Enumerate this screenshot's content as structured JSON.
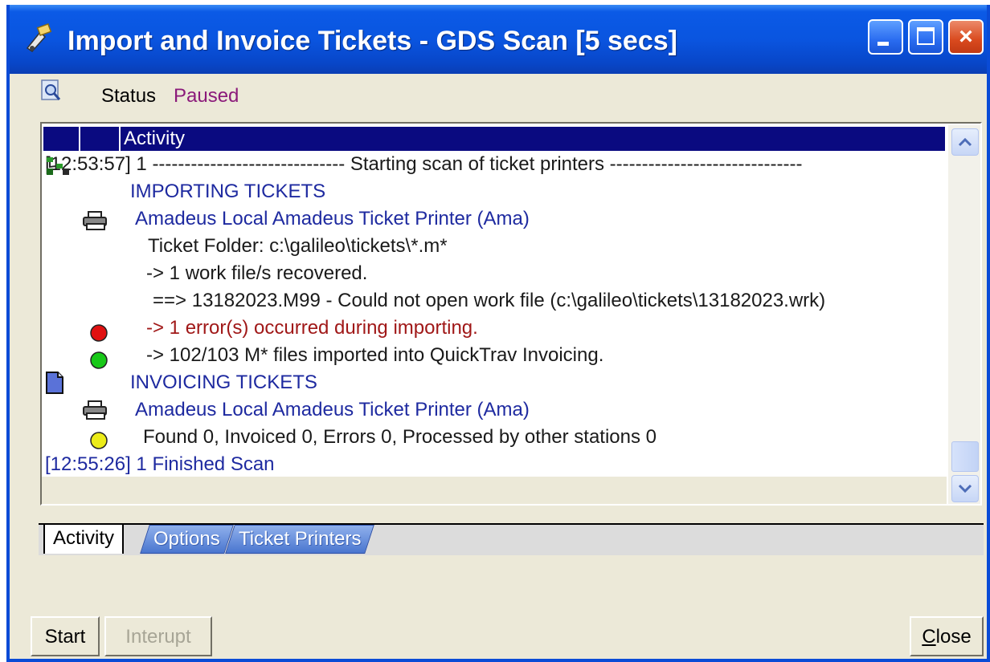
{
  "window": {
    "title": "Import and Invoice Tickets - GDS Scan [5 secs]",
    "controls": {
      "minimize": "minimize",
      "maximize": "maximize",
      "close": "×"
    }
  },
  "status": {
    "label": "Status",
    "value": "Paused"
  },
  "activity_list": {
    "header": "Activity",
    "rows": [
      {
        "text": "[12:53:57] 1 ------------------------------ Starting scan of ticket printers ------------------------------",
        "color": "black"
      },
      {
        "icon": "import-tickets-icon",
        "text": "IMPORTING TICKETS",
        "color": "blue"
      },
      {
        "icon": "printer-icon",
        "text": "Amadeus Local Amadeus Ticket Printer (Ama)",
        "color": "blue"
      },
      {
        "text": "Ticket Folder: c:\\galileo\\tickets\\*.m*",
        "color": "black"
      },
      {
        "text": "-> 1 work file/s recovered.",
        "color": "black"
      },
      {
        "text": "==> 13182023.M99 - Could not open work file (c:\\galileo\\tickets\\13182023.wrk)",
        "color": "black"
      },
      {
        "icon": "red-status-dot-icon",
        "text": "-> 1 error(s) occurred during importing.",
        "color": "red"
      },
      {
        "icon": "green-status-dot-icon",
        "text": "-> 102/103 M*  files imported into QuickTrav Invoicing.",
        "color": "black"
      },
      {
        "icon": "document-icon",
        "text": "INVOICING TICKETS",
        "color": "blue"
      },
      {
        "icon": "printer-icon",
        "text": "Amadeus Local Amadeus Ticket Printer (Ama)",
        "color": "blue"
      },
      {
        "icon": "yellow-status-dot-icon",
        "text": "Found 0, Invoiced 0, Errors 0, Processed by other stations 0",
        "color": "black"
      },
      {
        "text": "[12:55:26] 1 Finished Scan",
        "color": "blue"
      }
    ]
  },
  "tabs": [
    {
      "label": "Activity",
      "active": true
    },
    {
      "label": "Options",
      "active": false
    },
    {
      "label": "Ticket Printers",
      "active": false
    }
  ],
  "buttons": {
    "start": "Start",
    "interrupt": "Interupt",
    "close_first": "C",
    "close_rest": "lose"
  },
  "colors": {
    "titlebar": "#0a55e0",
    "header": "#0a0a80",
    "blue_text": "#1e2aa0",
    "error_text": "#a01818",
    "paused_text": "#8b1a7a"
  }
}
